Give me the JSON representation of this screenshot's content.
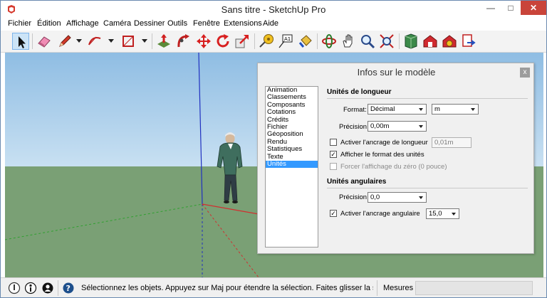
{
  "window": {
    "title": "Sans titre - SketchUp Pro",
    "minimize": "—",
    "maximize": "□",
    "close": "✕"
  },
  "menu": [
    "Fichier",
    "Édition",
    "Affichage",
    "Caméra",
    "Dessiner",
    "Outils",
    "Fenêtre",
    "Extensions",
    "Aide"
  ],
  "toolbar": {
    "tools": [
      "select-icon",
      "eraser-icon",
      "pencil-icon",
      "arc-icon",
      "rectangle-icon",
      "push-pull-icon",
      "follow-me-icon",
      "move-icon",
      "rotate-icon",
      "scale-icon",
      "tape-measure-icon",
      "text-icon",
      "paint-bucket-icon",
      "orbit-icon",
      "pan-icon",
      "zoom-icon",
      "zoom-extents-icon",
      "components-icon",
      "warehouse-icon",
      "extension-warehouse-icon",
      "send-to-layout-icon"
    ]
  },
  "colors": {
    "sky": "#a4c8e6",
    "ground": "#7aa075",
    "axis_red": "#d03030",
    "axis_blue": "#2030c0",
    "axis_green": "#30a030",
    "selection": "#3399ff"
  },
  "dialog": {
    "title": "Infos sur le modèle",
    "close": "x",
    "categories": [
      "Animation",
      "Classements",
      "Composants",
      "Cotations",
      "Crédits",
      "Fichier",
      "Géoposition",
      "Rendu",
      "Statistiques",
      "Texte",
      "Unités"
    ],
    "selected_category": "Unités",
    "length_section": {
      "heading": "Unités de longueur",
      "format_label": "Format:",
      "format_value": "Décimal",
      "unit_value": "m",
      "precision_label": "Précision:",
      "precision_value": "0,00m",
      "snap_label": "Activer l'ancrage de longueur",
      "snap_checked": false,
      "snap_value": "0,01m",
      "display_units_label": "Afficher le format des unités",
      "display_units_checked": true,
      "force_zero_label": "Forcer l'affichage du zéro (0 pouce)",
      "force_zero_checked": false
    },
    "angle_section": {
      "heading": "Unités angulaires",
      "precision_label": "Précision:",
      "precision_value": "0,0",
      "snap_label": "Activer l'ancrage angulaire",
      "snap_checked": true,
      "snap_value": "15,0"
    }
  },
  "status": {
    "text": "Sélectionnez les objets. Appuyez sur Maj pour étendre la sélection. Faites glisser la s...",
    "measures_label": "Mesures",
    "measures_value": ""
  }
}
